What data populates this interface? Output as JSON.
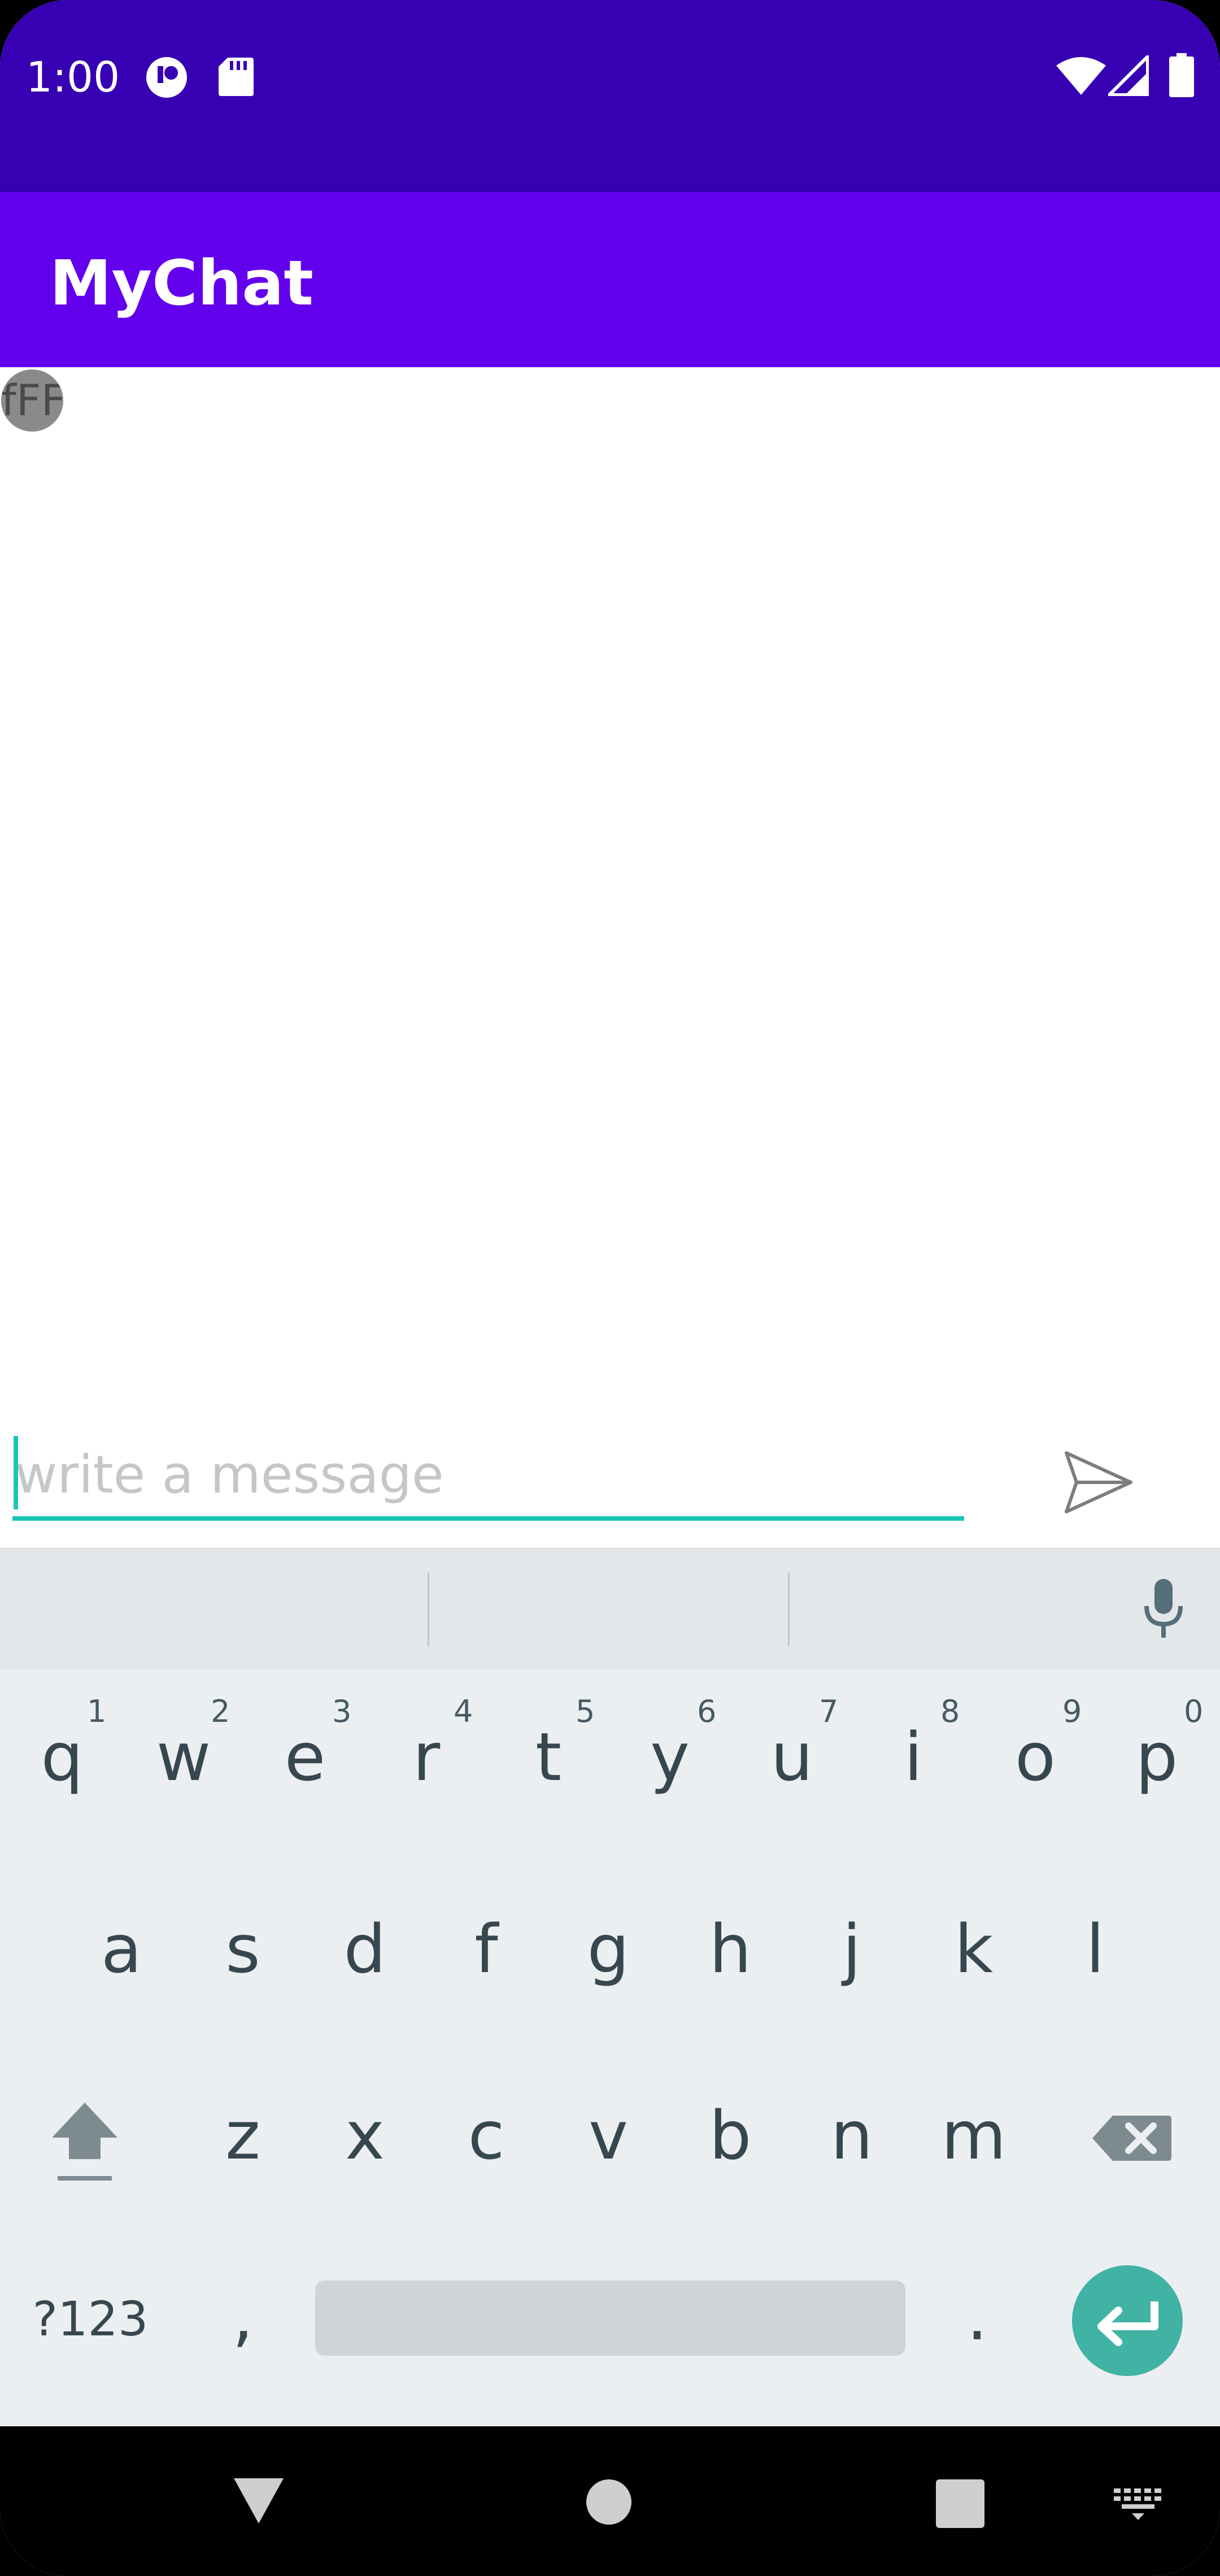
{
  "status_bar": {
    "time": "1:00",
    "left_icons": [
      "notification-app-icon",
      "sd-card-icon"
    ],
    "right_icons": [
      "wifi-icon",
      "cell-signal-icon",
      "battery-icon"
    ]
  },
  "app_bar": {
    "title": "MyChat"
  },
  "chat": {
    "messages": [
      {
        "avatar_text": "fFF"
      }
    ]
  },
  "composer": {
    "placeholder": "write a message",
    "value": "",
    "send_icon": "send-icon"
  },
  "keyboard": {
    "row1": [
      {
        "key": "q",
        "hint": "1"
      },
      {
        "key": "w",
        "hint": "2"
      },
      {
        "key": "e",
        "hint": "3"
      },
      {
        "key": "r",
        "hint": "4"
      },
      {
        "key": "t",
        "hint": "5"
      },
      {
        "key": "y",
        "hint": "6"
      },
      {
        "key": "u",
        "hint": "7"
      },
      {
        "key": "i",
        "hint": "8"
      },
      {
        "key": "o",
        "hint": "9"
      },
      {
        "key": "p",
        "hint": "0"
      }
    ],
    "row2": [
      "a",
      "s",
      "d",
      "f",
      "g",
      "h",
      "j",
      "k",
      "l"
    ],
    "row3": [
      "z",
      "x",
      "c",
      "v",
      "b",
      "n",
      "m"
    ],
    "symbols_label": "?123",
    "comma": ",",
    "period": ".",
    "accent_color": "#41b3a5"
  },
  "colors": {
    "status_bar": "#3700b3",
    "app_bar": "#6200ee",
    "input_accent": "#19c5b4"
  }
}
